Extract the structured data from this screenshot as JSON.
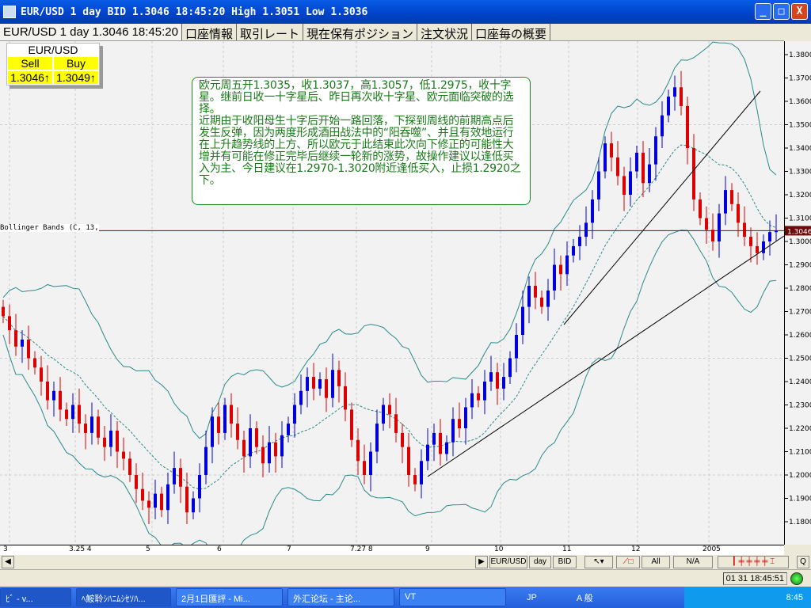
{
  "window": {
    "title": "EUR/USD 1 day BID 1.3046 18:45:20 High 1.3051 Low 1.3036",
    "min": "_",
    "max": "□",
    "close": "X"
  },
  "tabs": [
    "EUR/USD 1 day 1.3046 18:45:20",
    "口座情報",
    "取引レート",
    "現在保有ポジション",
    "注文状況",
    "口座毎の概要"
  ],
  "rate_panel": {
    "symbol": "EUR/USD",
    "sell_label": "Sell",
    "buy_label": "Buy",
    "sell": "1.3046↑",
    "buy": "1.3049↑"
  },
  "note": [
    "欧元周五开1.3035，收1.3037，高1.3057，低1.2975，收十字星。继前日收一十字星后、昨日再次收十字星、欧元面临突破的选择。",
    "近期由于收阳母生十字后开始一路回落，下探到周线的前期高点后发生反弹，因为两度形成酒田战法中的“阳吞噬”、并且有效地运行在上升趋势线的上方、所以欧元于此结束此次向下修正的可能性大增并有可能在修正完毕后继续一轮新的涨势，故操作建议以逢低买入为主、今日建议在1.2970-1.3020附近逢低买入，止损1.2920之下。"
  ],
  "indicator_label": "Bollinger Bands (C, 13,",
  "current_price_tag": "1.3046",
  "colors": {
    "up": "#0000dd",
    "down": "#dd0000",
    "band": "#2a8a8a",
    "price_line": "#8b0000",
    "note": "#1a7a1a"
  },
  "chart_data": {
    "type": "candlestick",
    "symbol": "EUR/USD",
    "timeframe": "1 day",
    "indicator": "Bollinger Bands (C, 13)",
    "ylim": [
      1.17,
      1.39
    ],
    "yticks": [
      "1.3800",
      "1.3700",
      "1.3600",
      "1.3500",
      "1.3400",
      "1.3300",
      "1.3200",
      "1.3100",
      "1.3000",
      "1.2900",
      "1.2800",
      "1.2700",
      "1.2600",
      "1.2500",
      "1.2400",
      "1.2300",
      "1.2200",
      "1.2100",
      "1.2000",
      "1.1900",
      "1.1800"
    ],
    "xticks": [
      "3",
      "3.25 4",
      "5",
      "6",
      "7",
      "7.27 8",
      "9",
      "10",
      "11",
      "12",
      "2005"
    ],
    "closes": [
      1.268,
      1.262,
      1.255,
      1.258,
      1.25,
      1.246,
      1.24,
      1.232,
      1.236,
      1.228,
      1.224,
      1.23,
      1.222,
      1.218,
      1.225,
      1.216,
      1.212,
      1.219,
      1.21,
      1.207,
      1.2,
      1.194,
      1.189,
      1.186,
      1.192,
      1.185,
      1.196,
      1.203,
      1.195,
      1.184,
      1.19,
      1.2,
      1.212,
      1.225,
      1.218,
      1.23,
      1.222,
      1.215,
      1.208,
      1.22,
      1.212,
      1.205,
      1.214,
      1.208,
      1.217,
      1.222,
      1.23,
      1.236,
      1.242,
      1.237,
      1.241,
      1.233,
      1.245,
      1.238,
      1.228,
      1.215,
      1.206,
      1.2,
      1.21,
      1.222,
      1.23,
      1.226,
      1.218,
      1.212,
      1.2,
      1.196,
      1.206,
      1.213,
      1.218,
      1.209,
      1.214,
      1.224,
      1.22,
      1.229,
      1.235,
      1.232,
      1.24,
      1.244,
      1.237,
      1.242,
      1.25,
      1.26,
      1.272,
      1.281,
      1.276,
      1.272,
      1.279,
      1.29,
      1.286,
      1.294,
      1.298,
      1.302,
      1.308,
      1.318,
      1.33,
      1.342,
      1.336,
      1.328,
      1.32,
      1.33,
      1.338,
      1.325,
      1.333,
      1.345,
      1.354,
      1.362,
      1.366,
      1.358,
      1.34,
      1.318,
      1.31,
      1.305,
      1.3,
      1.312,
      1.322,
      1.316,
      1.308,
      1.302,
      1.298,
      1.295,
      1.3,
      1.304,
      1.3046
    ],
    "current_price": 1.3046
  },
  "toolbar": {
    "symbol": "EUR/USD",
    "period": "day",
    "side": "BID",
    "all": "All",
    "na": "N/A",
    "q": "Q"
  },
  "status": {
    "time": "01 31 18:45:51"
  },
  "taskbar": {
    "tasks": [
      "ﾋﾞ - v...",
      "ﾍ鮟聆ｼﾊﾆﾑｼｾｿﾊ...",
      "2月1日匯評 - Mi...",
      "外汇论坛 - 主论...",
      "VT"
    ],
    "ime": "JP",
    "ime2": "A 般",
    "clock": "8:45"
  }
}
